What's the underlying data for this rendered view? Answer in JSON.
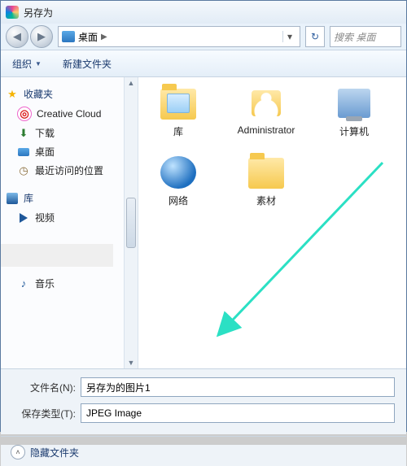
{
  "titlebar": {
    "title": "另存为"
  },
  "nav": {
    "breadcrumb_root": "桌面",
    "search_placeholder": "搜索 桌面"
  },
  "toolbar": {
    "organize": "组织",
    "new_folder": "新建文件夹"
  },
  "sidebar": {
    "favorites": "收藏夹",
    "creative_cloud": "Creative Cloud",
    "downloads": "下载",
    "desktop": "桌面",
    "recent": "最近访问的位置",
    "libraries": "库",
    "videos": "视频",
    "music": "音乐"
  },
  "content": {
    "items": [
      {
        "key": "libraries",
        "label": "库"
      },
      {
        "key": "administrator",
        "label": "Administrator"
      },
      {
        "key": "computer",
        "label": "计算机"
      },
      {
        "key": "network",
        "label": "网络"
      },
      {
        "key": "sucai",
        "label": "素材"
      }
    ]
  },
  "form": {
    "filename_label": "文件名(N):",
    "filename_value": "另存为的图片1",
    "filetype_label": "保存类型(T):",
    "filetype_value": "JPEG Image"
  },
  "footer": {
    "hide_folders": "隐藏文件夹"
  }
}
